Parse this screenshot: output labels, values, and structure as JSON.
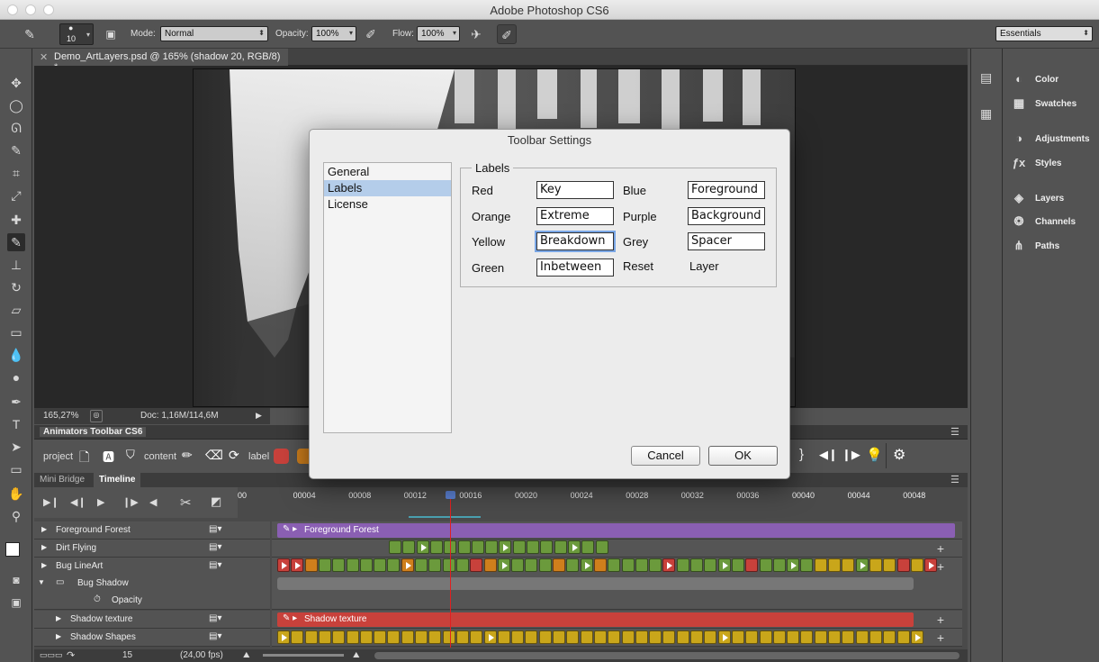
{
  "app": {
    "title": "Adobe Photoshop CS6"
  },
  "options_bar": {
    "brush_size": "10",
    "mode_label": "Mode:",
    "mode_value": "Normal",
    "opacity_label": "Opacity:",
    "opacity_value": "100%",
    "flow_label": "Flow:",
    "flow_value": "100%",
    "workspace": "Essentials"
  },
  "document": {
    "tab_title": "Demo_ArtLayers.psd @ 165% (shadow  20, RGB/8) *",
    "zoom": "165,27%",
    "doc_size": "Doc: 1,16M/114,6M"
  },
  "animators_panel": {
    "title": "Animators Toolbar CS6",
    "project_label": "project",
    "content_label": "content",
    "label_label": "label"
  },
  "timeline": {
    "tabs": [
      "Mini Bridge",
      "Timeline"
    ],
    "ruler": [
      "00",
      "00004",
      "00008",
      "00012",
      "00016",
      "00020",
      "00024",
      "00028",
      "00032",
      "00036",
      "00040",
      "00044",
      "00048"
    ],
    "layers": [
      "Foreground Forest",
      "Dirt Flying",
      "Bug LineArt",
      "Bug Shadow",
      "Opacity",
      "Shadow texture",
      "Shadow Shapes"
    ],
    "clips": {
      "foreground": "Foreground Forest",
      "shadow": "Shadow texture"
    },
    "frame": "15",
    "fps": "(24,00 fps)"
  },
  "right_panels": [
    "Color",
    "Swatches",
    "Adjustments",
    "Styles",
    "Layers",
    "Channels",
    "Paths"
  ],
  "dialog": {
    "title": "Toolbar Settings",
    "categories": [
      "General",
      "Labels",
      "License"
    ],
    "group_title": "Labels",
    "rows": [
      {
        "left_name": "Red",
        "left_value": "Key",
        "right_name": "Blue",
        "right_value": "Foreground"
      },
      {
        "left_name": "Orange",
        "left_value": "Extreme",
        "right_name": "Purple",
        "right_value": "Background"
      },
      {
        "left_name": "Yellow",
        "left_value": "Breakdown",
        "right_name": "Grey",
        "right_value": "Spacer"
      },
      {
        "left_name": "Green",
        "left_value": "Inbetween",
        "right_name": "Reset",
        "right_value": "Layer"
      }
    ],
    "cancel": "Cancel",
    "ok": "OK"
  },
  "colors": {
    "red": "#c8413b",
    "orange": "#cf7f1c",
    "yellow": "#c9a61a",
    "green": "#6b9a3c",
    "purple": "#8a5fb3",
    "selection": "#b4cdea"
  }
}
